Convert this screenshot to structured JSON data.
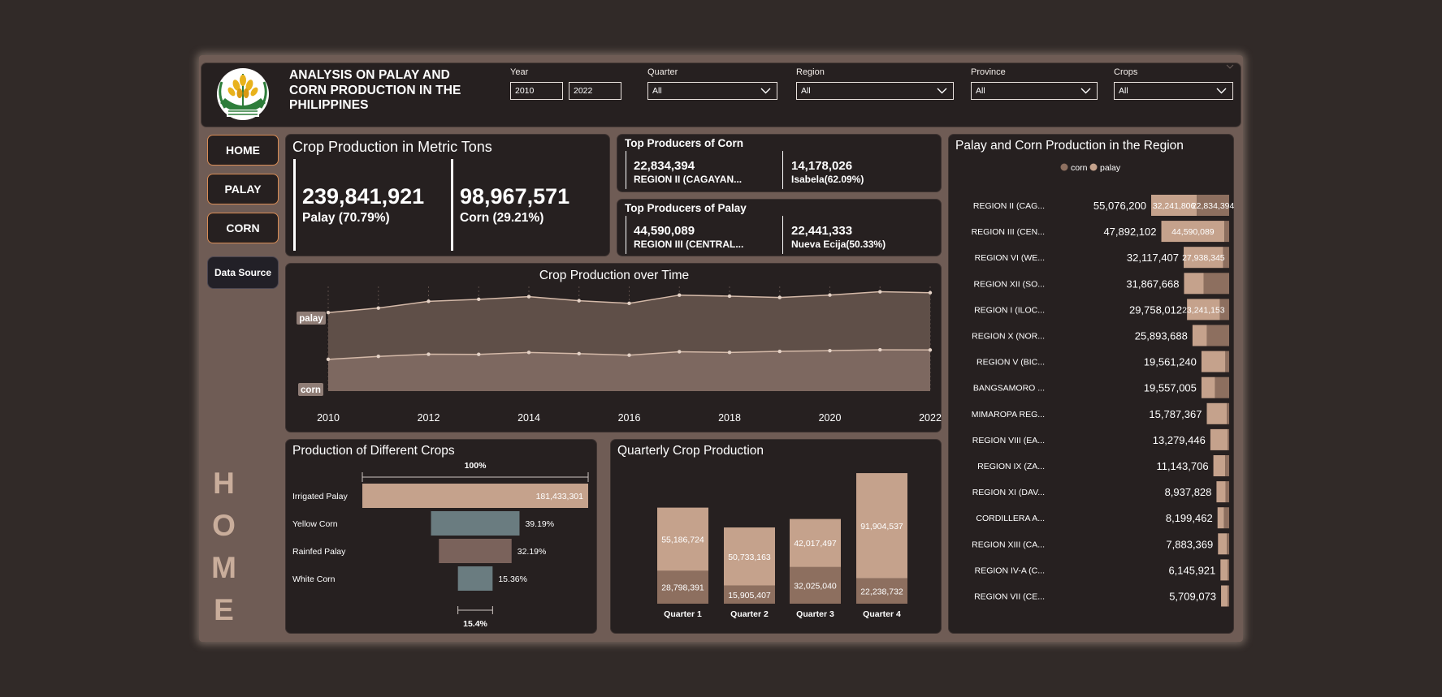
{
  "header": {
    "title": "ANALYSIS ON PALAY AND CORN PRODUCTION IN THE PHILIPPINES",
    "slicers": {
      "year_label": "Year",
      "year_from": "2010",
      "year_to": "2022",
      "quarter_label": "Quarter",
      "quarter_value": "All",
      "region_label": "Region",
      "region_value": "All",
      "province_label": "Province",
      "province_value": "All",
      "crops_label": "Crops",
      "crops_value": "All"
    }
  },
  "nav": {
    "home": "HOME",
    "palay": "PALAY",
    "corn": "CORN",
    "data_source": "Data Source",
    "page_letters": [
      "H",
      "O",
      "M",
      "E"
    ]
  },
  "kpi": {
    "title": "Crop Production in Metric Tons",
    "palay_value": "239,841,921",
    "palay_label": "Palay (70.79%)",
    "corn_value": "98,967,571",
    "corn_label": "Corn (29.21%)"
  },
  "top_corn": {
    "title": "Top Producers of Corn",
    "region_value": "22,834,394",
    "region_label": "REGION II (CAGAYAN...",
    "province_value": "14,178,026",
    "province_label": "Isabela(62.09%)"
  },
  "top_palay": {
    "title": "Top Producers of Palay",
    "region_value": "44,590,089",
    "region_label": "REGION III (CENTRAL...",
    "province_value": "22,441,333",
    "province_label": "Nueva Ecija(50.33%)"
  },
  "colors": {
    "palay": "#c5a28c",
    "corn": "#8d6f5f",
    "irrigated": "#c5a28c",
    "yellow_corn": "#6a7c80",
    "rainfed": "#7a625b",
    "white_corn": "#6a7c80",
    "card_bg": "#262020",
    "frame_bg": "#6f5c55",
    "nav_border": "#d98c55"
  },
  "chart_data": [
    {
      "type": "area",
      "title": "Crop Production over Time",
      "x": [
        2010,
        2011,
        2012,
        2013,
        2014,
        2015,
        2016,
        2017,
        2018,
        2019,
        2020,
        2021,
        2022
      ],
      "x_ticks": [
        "2010",
        "2012",
        "2014",
        "2016",
        "2018",
        "2020",
        "2022"
      ],
      "series": [
        {
          "name": "palay",
          "values": [
            15.77,
            16.68,
            18.03,
            18.44,
            18.97,
            18.15,
            17.63,
            19.28,
            19.07,
            18.81,
            19.29,
            19.96,
            19.76
          ]
        },
        {
          "name": "corn",
          "values": [
            6.38,
            6.97,
            7.41,
            7.38,
            7.77,
            7.52,
            7.22,
            7.91,
            7.77,
            7.98,
            8.12,
            8.3,
            8.26
          ]
        }
      ],
      "grid": false
    },
    {
      "type": "bar",
      "title": "Production of Different Crops",
      "categories": [
        "Irrigated Palay",
        "Yellow Corn",
        "Rainfed Palay",
        "White Corn"
      ],
      "values": [
        181433301,
        71100000,
        58400000,
        27870000
      ],
      "data_labels": [
        "181,433,301",
        "39.19%",
        "32.19%",
        "15.36%"
      ],
      "top_label": "100%",
      "bottom_label": "15.4%"
    },
    {
      "type": "bar",
      "title": "Quarterly Crop Production",
      "categories": [
        "Quarter 1",
        "Quarter 2",
        "Quarter 3",
        "Quarter 4"
      ],
      "series": [
        {
          "name": "corn",
          "values": [
            28798391,
            15905407,
            32025040,
            22238732
          ],
          "labels": [
            "28,798,391",
            "15,905,407",
            "32,025,040",
            "22,238,732"
          ]
        },
        {
          "name": "palay",
          "values": [
            55186724,
            50733163,
            42017497,
            91904537
          ],
          "labels": [
            "55,186,724",
            "50,733,163",
            "42,017,497",
            "91,904,537"
          ]
        }
      ],
      "stacked": true
    },
    {
      "type": "bar",
      "title": "Palay and Corn Production in the Region",
      "legend": [
        "corn",
        "palay"
      ],
      "legend_position": "top-center",
      "categories": [
        "REGION II (CAG...",
        "REGION III (CEN...",
        "REGION VI (WE...",
        "REGION XII (SO...",
        "REGION I (ILOC...",
        "REGION X (NOR...",
        "REGION V (BIC...",
        "BANGSAMORO ...",
        "MIMAROPA REG...",
        "REGION VIII (EA...",
        "REGION IX (ZA...",
        "REGION XI (DAV...",
        "CORDILLERA A...",
        "REGION XIII (CA...",
        "REGION IV-A (C...",
        "REGION VII (CE..."
      ],
      "totals": [
        55076200,
        47892102,
        32117407,
        31867668,
        29758012,
        25893688,
        19561240,
        19557005,
        15787367,
        13279446,
        11143706,
        8937828,
        8199462,
        7883369,
        6145921,
        5709073
      ],
      "total_labels": [
        "55,076,200",
        "47,892,102",
        "32,117,407",
        "31,867,668",
        "29,758,012",
        "25,893,688",
        "19,561,240",
        "19,557,005",
        "15,787,367",
        "13,279,446",
        "11,143,706",
        "8,937,828",
        "8,199,462",
        "7,883,369",
        "6,145,921",
        "5,709,073"
      ],
      "series": [
        {
          "name": "palay",
          "values": [
            32241806,
            44590089,
            27938345,
            13800000,
            23241153,
            10200000,
            16900000,
            9500000,
            14200000,
            12200000,
            8300000,
            6500000,
            4600000,
            6300000,
            5000000,
            4600000
          ],
          "labels": [
            "32,241,806",
            "44,590,089",
            "27,938,345",
            "",
            "23,241,153",
            "",
            "",
            "",
            "",
            "",
            "",
            "",
            "",
            "",
            "",
            ""
          ]
        },
        {
          "name": "corn",
          "values": [
            22834394,
            3302013,
            4179062,
            18067668,
            6516859,
            15693688,
            2661240,
            10057005,
            1587367,
            1079446,
            2843706,
            2437828,
            3599462,
            1583369,
            1145921,
            1109073
          ],
          "labels": [
            "22,834,394",
            "",
            "",
            "",
            "",
            "",
            "",
            "",
            "",
            "",
            "",
            "",
            "",
            "",
            "",
            ""
          ]
        }
      ]
    }
  ]
}
